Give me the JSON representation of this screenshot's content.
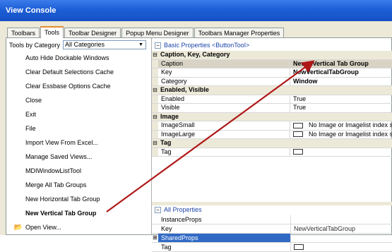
{
  "window": {
    "title": "View Console"
  },
  "tabs": [
    "Toolbars",
    "Tools",
    "Toolbar Designer",
    "Popup Menu Designer",
    "Toolbars Manager Properties"
  ],
  "active_tab": "Tools",
  "category_filter": {
    "label": "Tools by Category",
    "value": "All Categories"
  },
  "tools": [
    {
      "label": "Auto Hide Dockable Windows",
      "bold": false,
      "icon": ""
    },
    {
      "label": "Clear Default Selections Cache",
      "bold": false,
      "icon": ""
    },
    {
      "label": "Clear Essbase Options Cache",
      "bold": false,
      "icon": ""
    },
    {
      "label": "Close",
      "bold": false,
      "icon": ""
    },
    {
      "label": "Exit",
      "bold": false,
      "icon": ""
    },
    {
      "label": "File",
      "bold": false,
      "icon": ""
    },
    {
      "label": "Import View From Excel...",
      "bold": false,
      "icon": ""
    },
    {
      "label": "Manage Saved Views...",
      "bold": false,
      "icon": ""
    },
    {
      "label": "MDIWindowListTool",
      "bold": false,
      "icon": ""
    },
    {
      "label": "Merge All Tab Groups",
      "bold": false,
      "icon": ""
    },
    {
      "label": "New Horizontal Tab Group",
      "bold": false,
      "icon": ""
    },
    {
      "label": "New Vertical Tab Group",
      "bold": true,
      "icon": ""
    },
    {
      "label": "Open View...",
      "bold": false,
      "icon": "folder-icon"
    }
  ],
  "properties": {
    "header": "Basic Properties <ButtonTool>",
    "categories": [
      {
        "name": "Caption, Key, Category",
        "rows": [
          {
            "name": "Caption",
            "value": "New &Vertical Tab Group",
            "bold": true,
            "selected": true
          },
          {
            "name": "Key",
            "value": "NewVerticalTabGroup",
            "bold": true
          },
          {
            "name": "Category",
            "value": "Window",
            "bold": true
          }
        ]
      },
      {
        "name": "Enabled, Visible",
        "rows": [
          {
            "name": "Enabled",
            "value": "True"
          },
          {
            "name": "Visible",
            "value": "True"
          }
        ]
      },
      {
        "name": "Image",
        "rows": [
          {
            "name": "ImageSmall",
            "value": "No Image or Imagelist index specified",
            "box": true
          },
          {
            "name": "ImageLarge",
            "value": "No Image or Imagelist index specified",
            "box": true
          }
        ]
      },
      {
        "name": "Tag",
        "rows": [
          {
            "name": "Tag",
            "value": "",
            "box": true
          }
        ]
      }
    ]
  },
  "all_properties": {
    "header": "All Properties",
    "rows": [
      {
        "name": "InstanceProps",
        "value": ""
      },
      {
        "name": "Key",
        "value": "NewVerticalTabGroup"
      },
      {
        "name": "SharedProps",
        "value": "",
        "expander": "+",
        "highlight": true
      },
      {
        "name": "Tag",
        "value": "",
        "box": true
      }
    ]
  },
  "colors": {
    "titlebar": "#1d5fd6",
    "arrow": "#b01818",
    "selection": "#316ac5"
  }
}
